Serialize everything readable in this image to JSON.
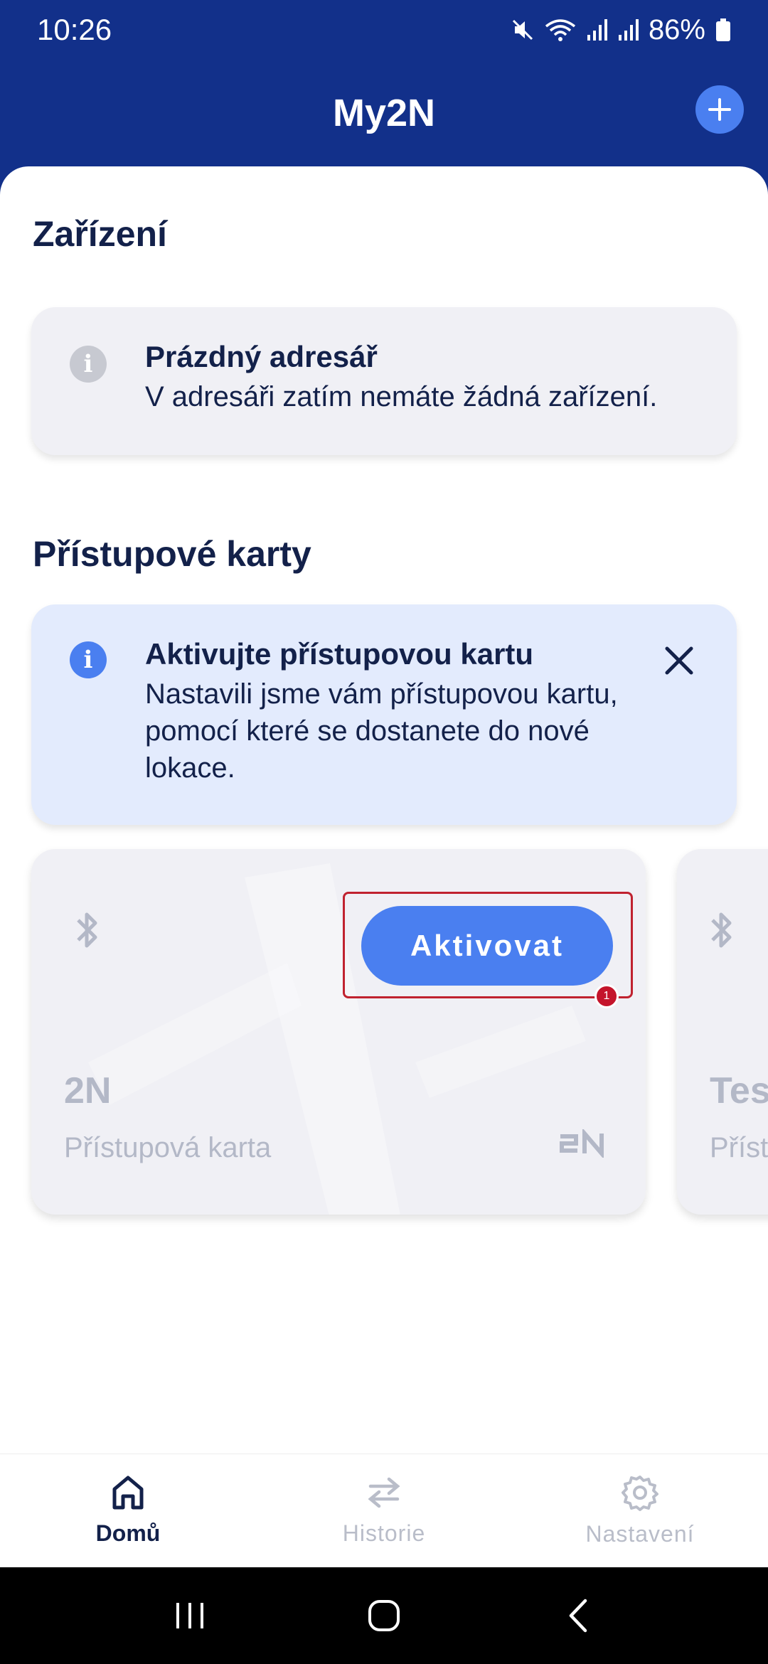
{
  "status_bar": {
    "time": "10:26",
    "battery": "86%",
    "icons": [
      "mute-icon",
      "wifi-icon",
      "signal-icon",
      "signal-icon",
      "battery-icon"
    ]
  },
  "app_bar": {
    "title": "My2N",
    "add_icon": "plus-icon"
  },
  "devices_section": {
    "title": "Zařízení",
    "info": {
      "icon": "info-icon",
      "heading": "Prázdný adresář",
      "body": "V adresáři zatím nemáte žádná zařízení."
    }
  },
  "cards_section": {
    "title": "Přístupové karty",
    "banner": {
      "icon": "info-icon",
      "heading": "Aktivujte přístupovou kartu",
      "body": "Nastavili jsme vám přístupovou kartu, pomocí které se dostanete do nové lokace.",
      "close_icon": "close-icon"
    },
    "cards": [
      {
        "name": "2N",
        "type": "Přístupová karta",
        "logo": "2N",
        "button_label": "Aktivovat",
        "badge": "1",
        "icon": "bluetooth-icon"
      },
      {
        "name": "Tes",
        "type": "Příst",
        "icon": "bluetooth-icon"
      }
    ]
  },
  "bottom_nav": {
    "items": [
      {
        "label": "Domů",
        "icon": "home-icon",
        "active": true
      },
      {
        "label": "Historie",
        "icon": "history-icon",
        "active": false
      },
      {
        "label": "Nastavení",
        "icon": "gear-icon",
        "active": false
      }
    ]
  },
  "colors": {
    "header_bg": "#12308a",
    "accent": "#4a7ff0",
    "text_dark": "#13214a",
    "highlight": "#c0222f"
  }
}
